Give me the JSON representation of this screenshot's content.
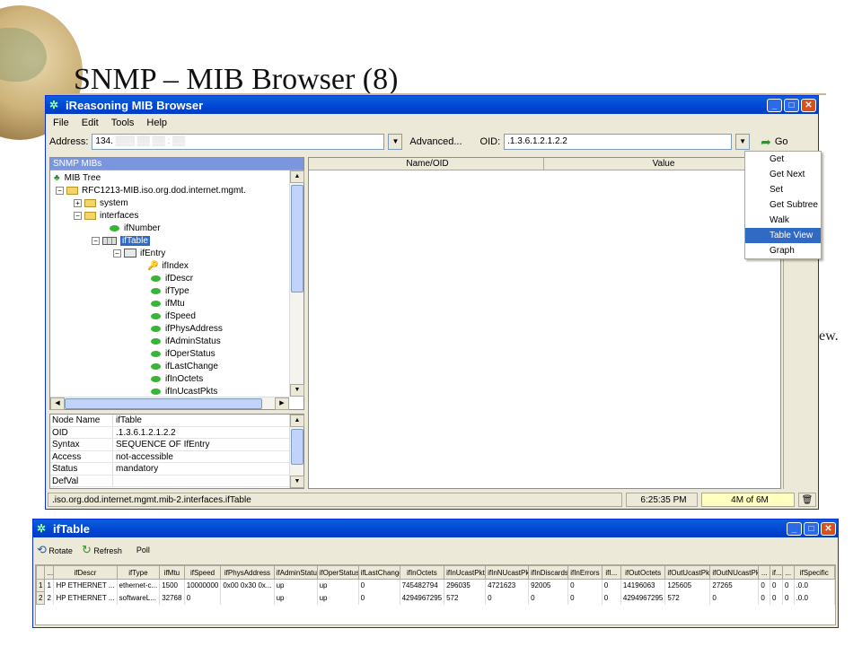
{
  "slide": {
    "title": "SNMP – MIB Browser (8)",
    "bg_fragment": "ew."
  },
  "browser": {
    "title": "iReasoning MIB Browser",
    "menu": [
      "File",
      "Edit",
      "Tools",
      "Help"
    ],
    "address_label": "Address:",
    "address_value": "134.",
    "advanced_label": "Advanced...",
    "oid_label": "OID:",
    "oid_value": ".1.3.6.1.2.1.2.2",
    "go_label": "Go",
    "tree_header": "SNMP MIBs",
    "tree": [
      "MIB Tree",
      "RFC1213-MIB.iso.org.dod.internet.mgmt.",
      "system",
      "interfaces",
      "ifNumber",
      "ifTable",
      "ifEntry",
      "ifIndex",
      "ifDescr",
      "ifType",
      "ifMtu",
      "ifSpeed",
      "ifPhysAddress",
      "ifAdminStatus",
      "ifOperStatus",
      "ifLastChange",
      "ifInOctets",
      "ifInUcastPkts"
    ],
    "result_columns": [
      "Name/OID",
      "Value"
    ],
    "ops_menu": [
      "Get",
      "Get Next",
      "Set",
      "Get Subtree",
      "Walk",
      "Table View",
      "Graph"
    ],
    "ops_selected": "Table View",
    "props": [
      [
        "Node Name",
        "ifTable"
      ],
      [
        "OID",
        ".1.3.6.1.2.1.2.2"
      ],
      [
        "Syntax",
        "SEQUENCE OF IfEntry"
      ],
      [
        "Access",
        "not-accessible"
      ],
      [
        "Status",
        "mandatory"
      ],
      [
        "DefVal",
        ""
      ]
    ],
    "status_path": ".iso.org.dod.internet.mgmt.mib-2.interfaces.ifTable",
    "status_time": "6:25:35 PM",
    "status_mem": "4M of 6M"
  },
  "table_window": {
    "title": "ifTable",
    "toolbar": [
      "Rotate",
      "Refresh",
      "Poll"
    ],
    "columns": [
      "...",
      "ifDescr",
      "ifType",
      "ifMtu",
      "ifSpeed",
      "ifPhysAddress",
      "ifAdminStatus",
      "ifOperStatus",
      "ifLastChange",
      "ifInOctets",
      "ifInUcastPkts",
      "ifInNUcastPkts",
      "ifInDiscards",
      "ifInErrors",
      "ifI...",
      "ifOutOctets",
      "ifOutUcastPkts",
      "ifOutNUcastPkts",
      "...",
      "if...",
      "...",
      "ifSpecific"
    ],
    "rows": [
      [
        "1",
        "1",
        "HP ETHERNET ...",
        "ethernet-c...",
        "1500",
        "10000000",
        "0x00 0x30 0x...",
        "up",
        "up",
        "0",
        "745482794",
        "296035",
        "4721623",
        "92005",
        "0",
        "0",
        "14196063",
        "125605",
        "27265",
        "0",
        "0",
        "0",
        ".0.0"
      ],
      [
        "2",
        "2",
        "HP ETHERNET ...",
        "softwareL...",
        "32768",
        "0",
        "",
        "up",
        "up",
        "0",
        "4294967295",
        "572",
        "0",
        "0",
        "0",
        "0",
        "4294967295",
        "572",
        "0",
        "0",
        "0",
        "0",
        ".0.0"
      ]
    ]
  }
}
